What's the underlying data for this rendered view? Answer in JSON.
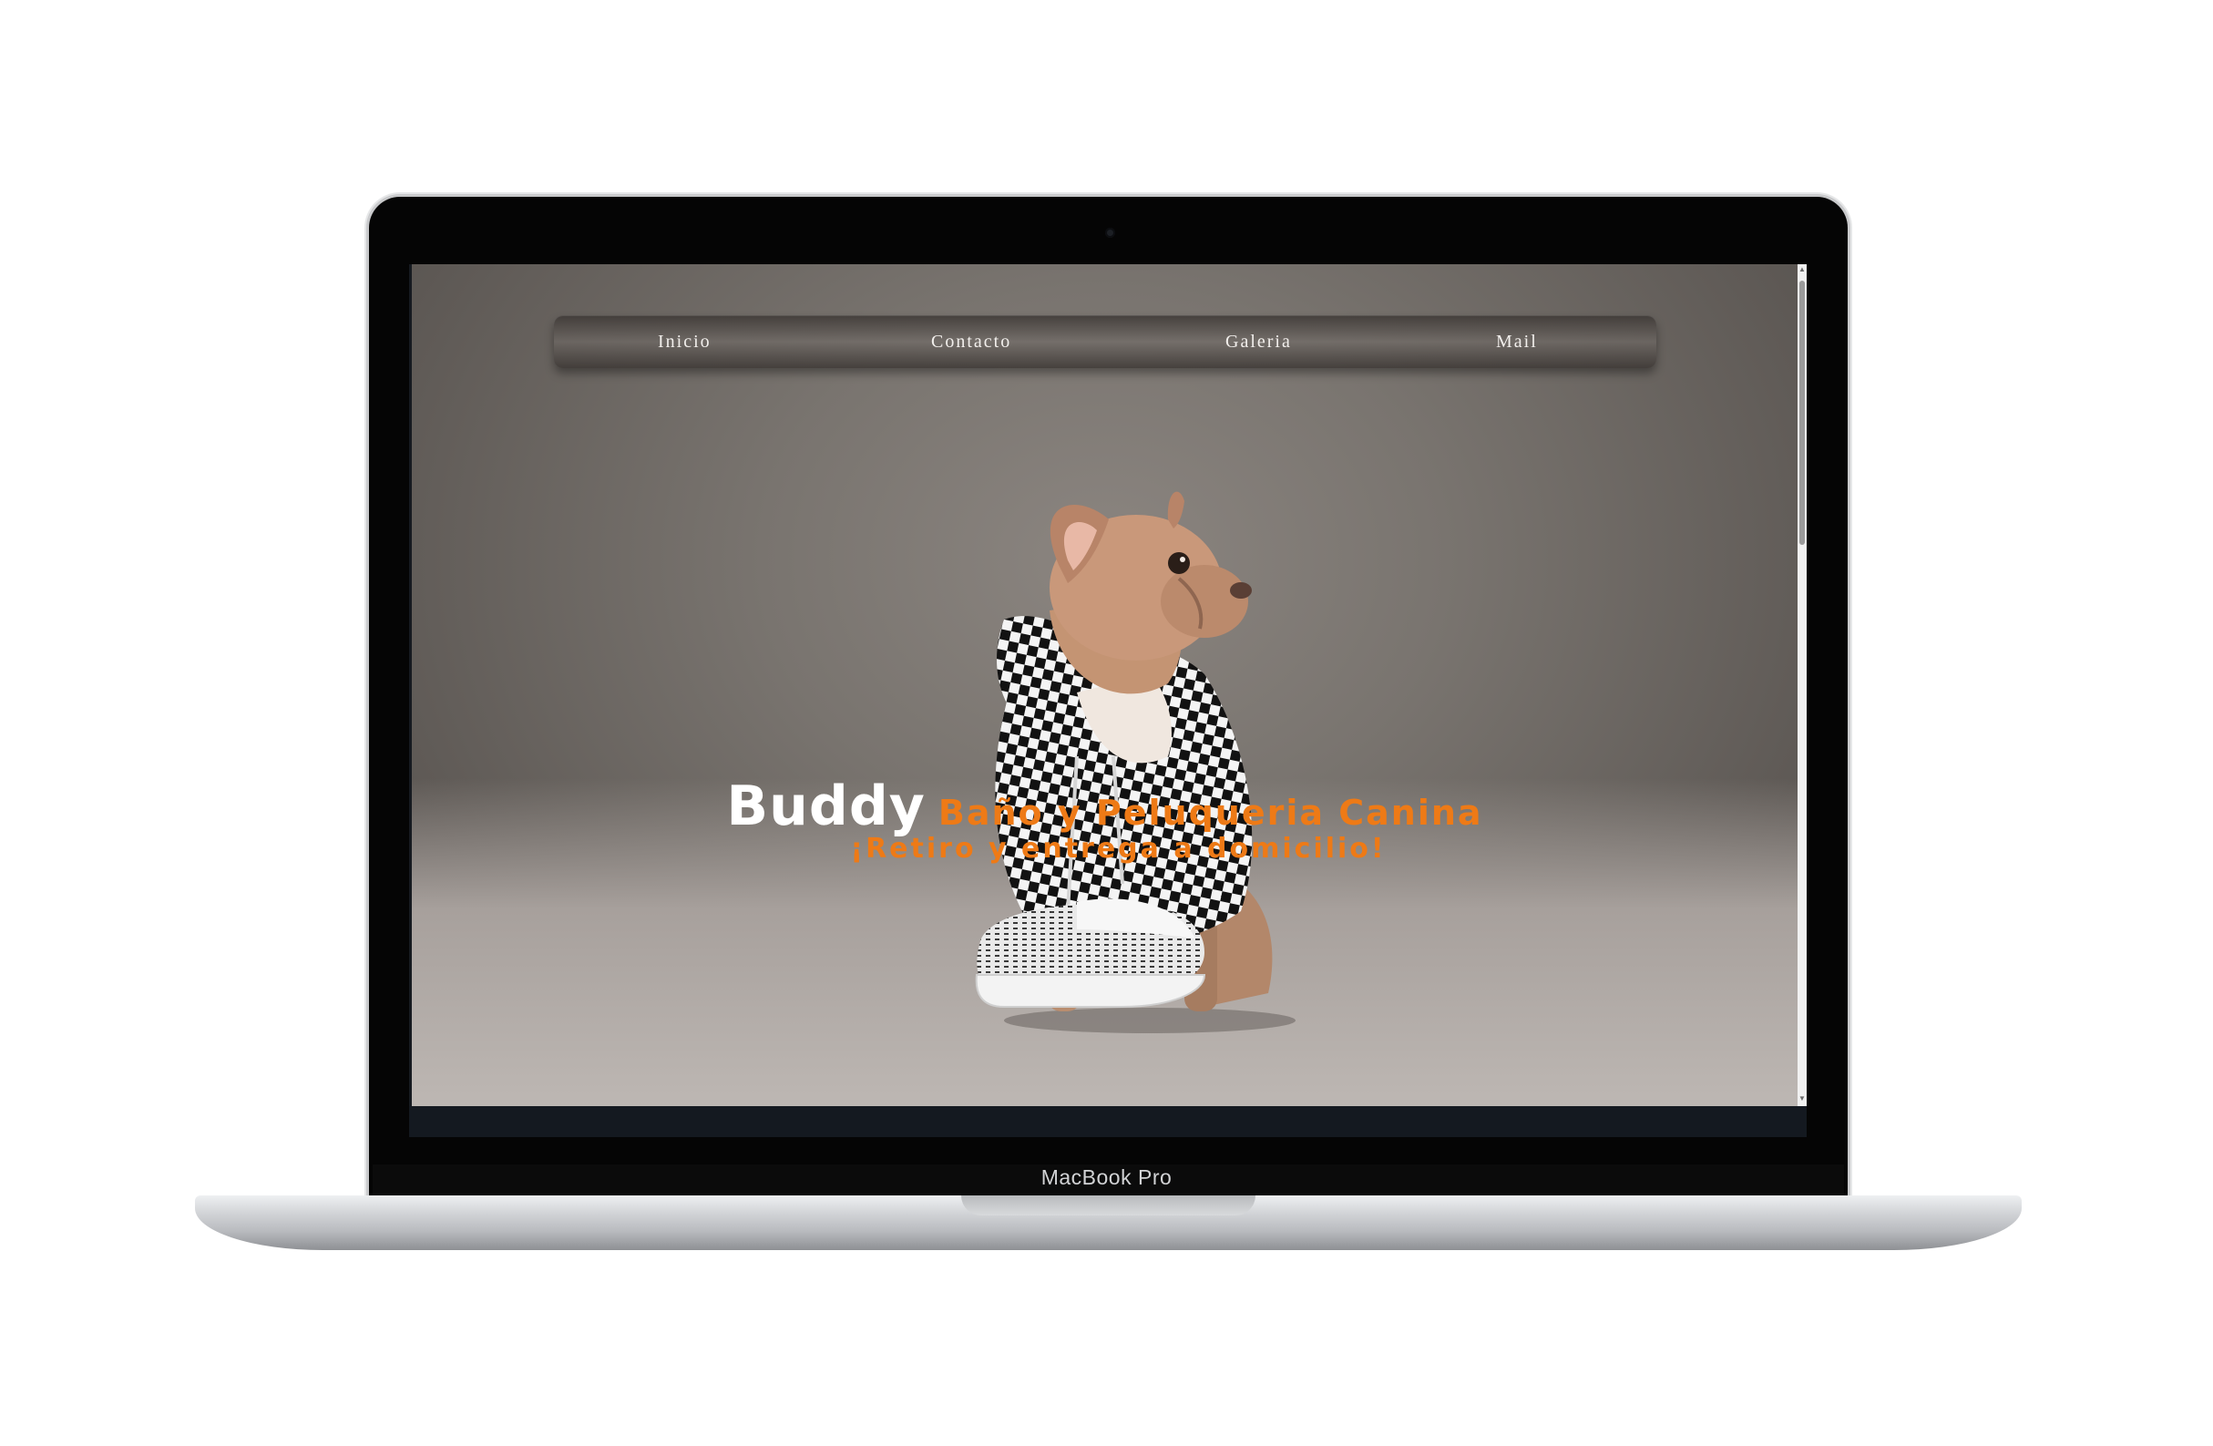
{
  "device": {
    "label": "MacBook Pro"
  },
  "nav": {
    "items": [
      {
        "label": "Inicio"
      },
      {
        "label": "Contacto"
      },
      {
        "label": "Galeria"
      },
      {
        "label": "Mail"
      }
    ]
  },
  "hero": {
    "brand": "Buddy",
    "tagline": "Baño y Peluqueria Canina",
    "subtagline": "¡Retiro y entrega a domicilio!",
    "image": "french-bulldog-in-checkered-hoodie-with-sneaker"
  },
  "colors": {
    "accent": "#ee7a16",
    "brand_text": "#ffffff",
    "nav_text": "#f2efec",
    "page_footer": "#141920"
  },
  "icons": [
    "camera-icon",
    "scroll-up-icon",
    "scroll-down-icon"
  ]
}
